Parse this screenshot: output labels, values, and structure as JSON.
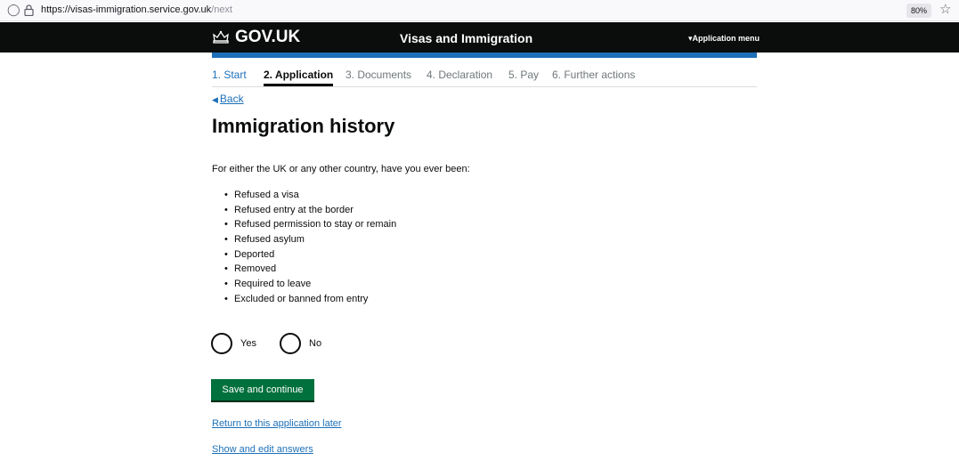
{
  "browser": {
    "url_host": "https://visas-immigration.service.gov.uk",
    "url_path": "/next",
    "zoom": "80%"
  },
  "header": {
    "logo_text": "GOV.UK",
    "service_name": "Visas and Immigration",
    "app_menu_label": "▾Application menu"
  },
  "steps": {
    "items": [
      {
        "label": "1. Start",
        "state": "done"
      },
      {
        "label": "2. Application",
        "state": "current"
      },
      {
        "label": "3. Documents",
        "state": "todo"
      },
      {
        "label": "4. Declaration",
        "state": "todo"
      },
      {
        "label": "5. Pay",
        "state": "todo"
      },
      {
        "label": "6. Further actions",
        "state": "todo"
      }
    ]
  },
  "back_label": "Back",
  "page_title": "Immigration history",
  "question": "For either the UK or any other country, have you ever been:",
  "reasons": [
    "Refused a visa",
    "Refused entry at the border",
    "Refused permission to stay or remain",
    "Refused asylum",
    "Deported",
    "Removed",
    "Required to leave",
    "Excluded or banned from entry"
  ],
  "options": {
    "yes": "Yes",
    "no": "No"
  },
  "save_label": "Save and continue",
  "links": {
    "return_later": "Return to this application later",
    "show_edit": "Show and edit answers"
  },
  "colors": {
    "header_bg": "#0b0c0c",
    "brand_blue": "#1d70b8",
    "button_green": "#00703c"
  }
}
